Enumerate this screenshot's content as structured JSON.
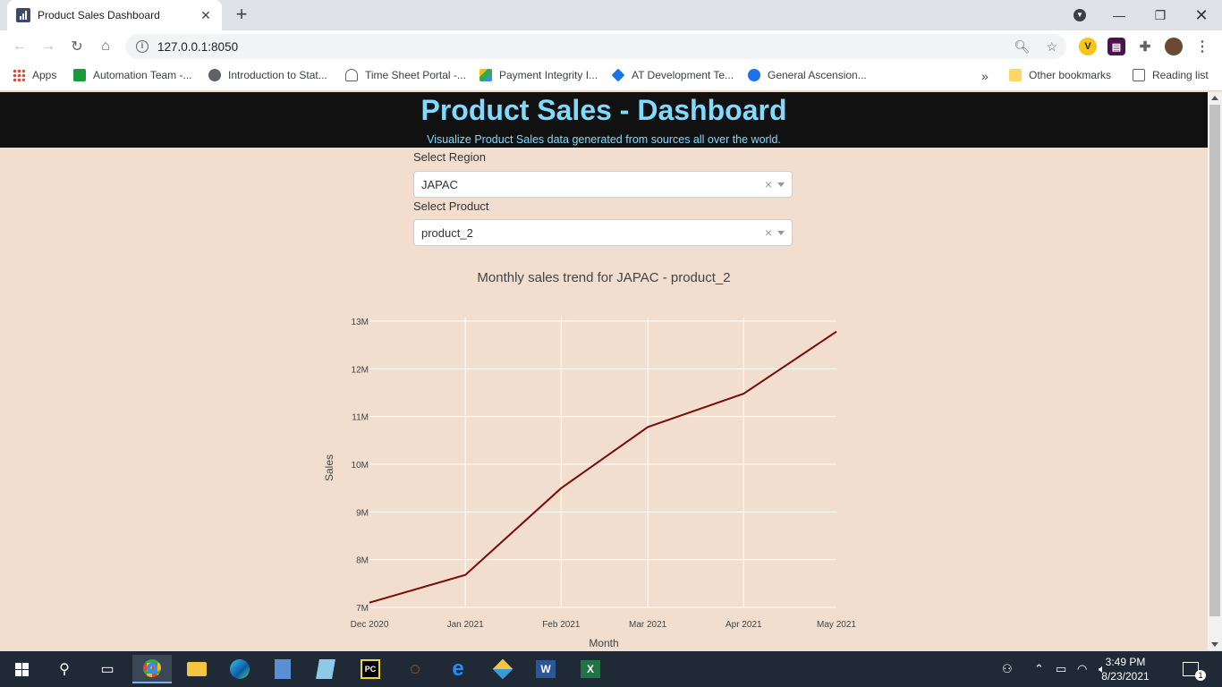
{
  "browser": {
    "tab_title": "Product Sales Dashboard",
    "url": "127.0.0.1:8050",
    "bookmarks": [
      {
        "label": "Apps",
        "color": "#ea4335"
      },
      {
        "label": "Automation Team -...",
        "color": "#1a9b3d"
      },
      {
        "label": "Introduction to Stat...",
        "color": "#5f6368"
      },
      {
        "label": "Time Sheet Portal -...",
        "color": "#5f6368"
      },
      {
        "label": "Payment Integrity I...",
        "color": "#fbbc04"
      },
      {
        "label": "AT Development Te...",
        "color": "#1a73e8"
      },
      {
        "label": "General Ascension...",
        "color": "#1a73e8"
      }
    ],
    "overflow": "»",
    "other_bookmarks": "Other bookmarks",
    "reading_list": "Reading list"
  },
  "header": {
    "title": "Product Sales - Dashboard",
    "subtitle": "Visualize Product Sales data generated from sources all over the world.",
    "title_color": "#7fdbff",
    "background": "#111111"
  },
  "filters": {
    "region_label": "Select Region",
    "region_value": "JAPAC",
    "product_label": "Select Product",
    "product_value": "product_2"
  },
  "chart_data": {
    "type": "line",
    "title": "Monthly sales trend for JAPAC - product_2",
    "xlabel": "Month",
    "ylabel": "Sales",
    "x": [
      "Dec 2020",
      "Jan 2021",
      "Feb 2021",
      "Mar 2021",
      "Apr 2021",
      "May 2021"
    ],
    "x_days": [
      0,
      31,
      62,
      90,
      121,
      151
    ],
    "values": [
      7.1,
      7.68,
      9.5,
      10.78,
      11.48,
      12.78
    ],
    "ylim": [
      7,
      13
    ],
    "y_ticks": [
      "7M",
      "8M",
      "9M",
      "10M",
      "11M",
      "12M",
      "13M"
    ],
    "line_color": "#7b0a0a",
    "grid": true
  },
  "taskbar": {
    "time": "3:49 PM",
    "date": "8/23/2021",
    "notifications": "1"
  }
}
